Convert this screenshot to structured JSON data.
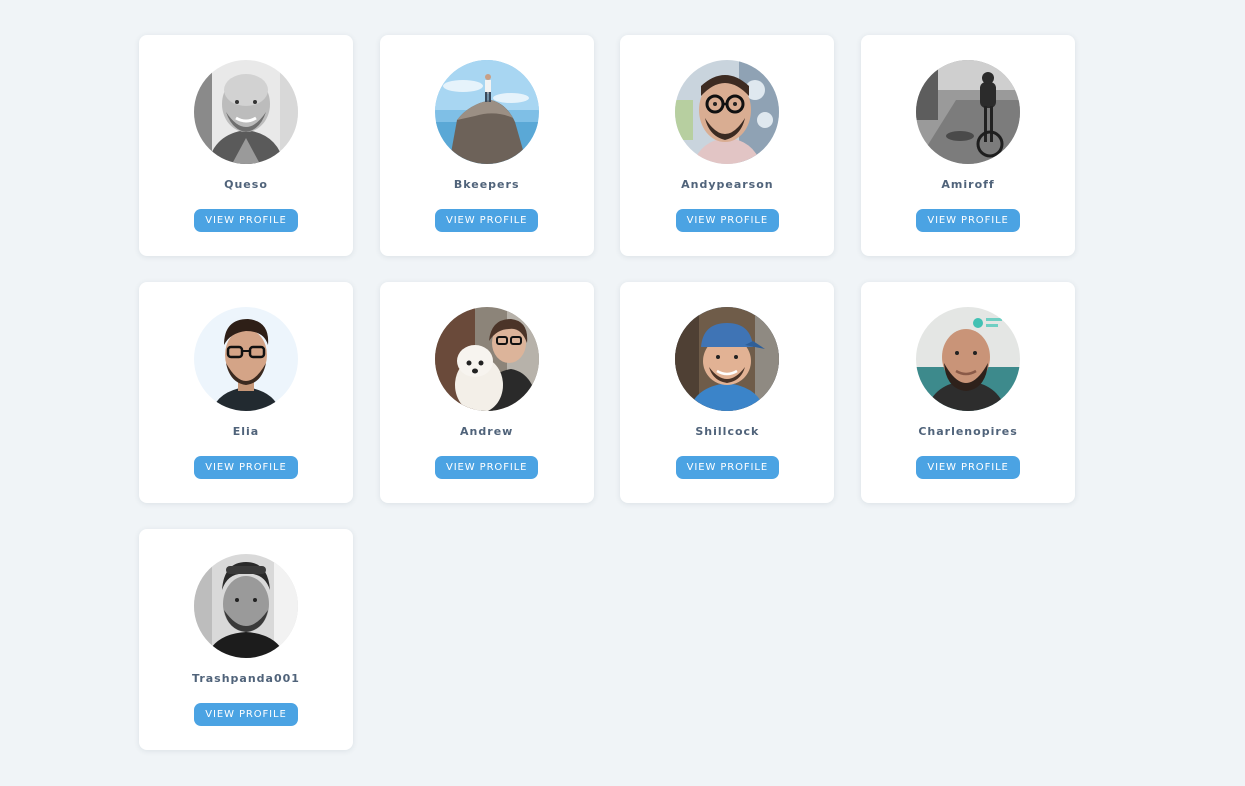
{
  "cards": [
    {
      "username": "Queso",
      "button_label": "VIEW PROFILE",
      "avatar_icon": "avatar-photo-icon"
    },
    {
      "username": "Bkeepers",
      "button_label": "VIEW PROFILE",
      "avatar_icon": "avatar-photo-icon"
    },
    {
      "username": "Andypearson",
      "button_label": "VIEW PROFILE",
      "avatar_icon": "avatar-photo-icon"
    },
    {
      "username": "Amiroff",
      "button_label": "VIEW PROFILE",
      "avatar_icon": "avatar-photo-icon"
    },
    {
      "username": "Elia",
      "button_label": "VIEW PROFILE",
      "avatar_icon": "avatar-photo-icon"
    },
    {
      "username": "Andrew",
      "button_label": "VIEW PROFILE",
      "avatar_icon": "avatar-photo-icon"
    },
    {
      "username": "Shillcock",
      "button_label": "VIEW PROFILE",
      "avatar_icon": "avatar-photo-icon"
    },
    {
      "username": "Charlenopires",
      "button_label": "VIEW PROFILE",
      "avatar_icon": "avatar-photo-icon"
    },
    {
      "username": "Trashpanda001",
      "button_label": "VIEW PROFILE",
      "avatar_icon": "avatar-photo-icon"
    }
  ],
  "colors": {
    "page_background": "#f0f4f7",
    "card_background": "#ffffff",
    "button": "#4ba3e3",
    "username_text": "#50637a"
  }
}
